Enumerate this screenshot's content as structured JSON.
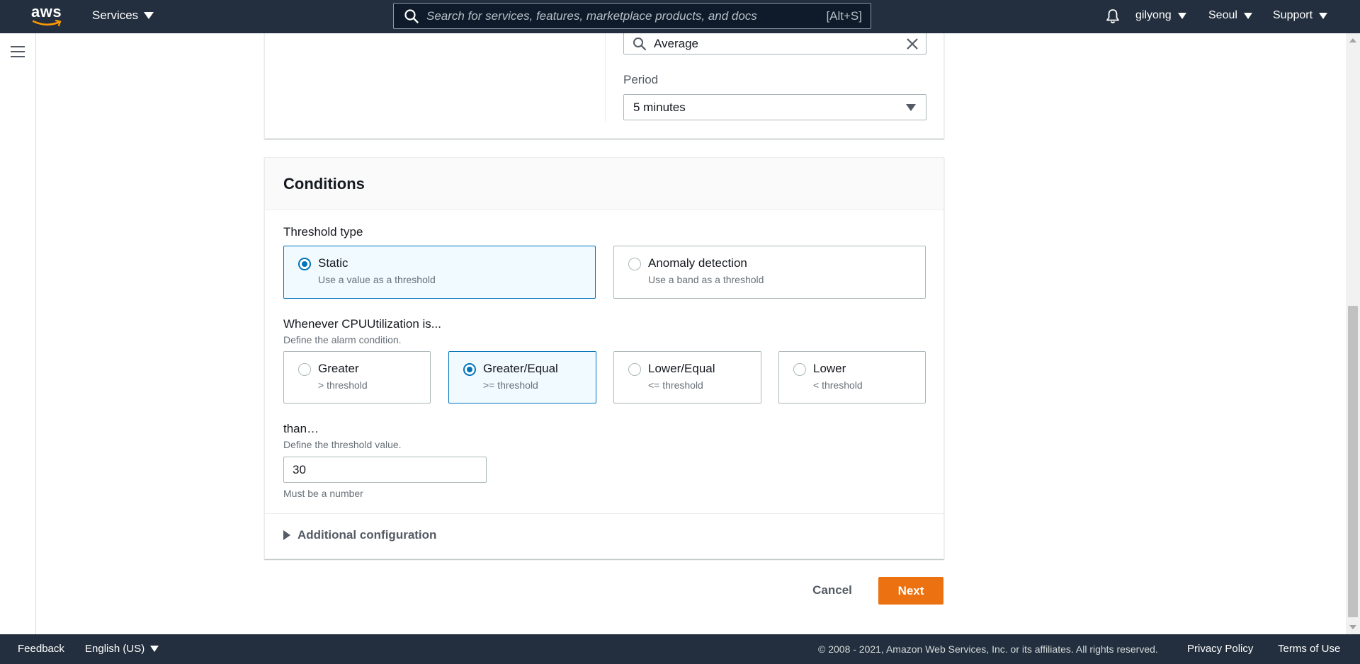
{
  "topnav": {
    "logo_text": "aws",
    "services_label": "Services",
    "search_placeholder": "Search for services, features, marketplace products, and docs",
    "search_shortcut": "[Alt+S]",
    "user_label": "gilyong",
    "region_label": "Seoul",
    "support_label": "Support"
  },
  "metric": {
    "statistic_value": "Average",
    "period_label": "Period",
    "period_value": "5 minutes"
  },
  "conditions": {
    "title": "Conditions",
    "threshold_type_label": "Threshold type",
    "threshold_types": [
      {
        "title": "Static",
        "desc": "Use a value as a threshold",
        "selected": true
      },
      {
        "title": "Anomaly detection",
        "desc": "Use a band as a threshold",
        "selected": false
      }
    ],
    "whenever_label": "Whenever CPUUtilization is...",
    "whenever_desc": "Define the alarm condition.",
    "operators": [
      {
        "title": "Greater",
        "desc": "> threshold",
        "selected": false
      },
      {
        "title": "Greater/Equal",
        "desc": ">= threshold",
        "selected": true
      },
      {
        "title": "Lower/Equal",
        "desc": "<= threshold",
        "selected": false
      },
      {
        "title": "Lower",
        "desc": "< threshold",
        "selected": false
      }
    ],
    "than_label": "than…",
    "than_desc": "Define the threshold value.",
    "threshold_value": "30",
    "threshold_constraint": "Must be a number",
    "additional_config_label": "Additional configuration"
  },
  "actions": {
    "cancel_label": "Cancel",
    "next_label": "Next"
  },
  "footer": {
    "feedback_label": "Feedback",
    "language_label": "English (US)",
    "copyright": "© 2008 - 2021, Amazon Web Services, Inc. or its affiliates. All rights reserved.",
    "privacy_label": "Privacy Policy",
    "terms_label": "Terms of Use"
  },
  "colors": {
    "nav_bg": "#232f3e",
    "accent_orange": "#ec7211",
    "selected_blue": "#0073bb",
    "selected_bg": "#f1faff"
  }
}
